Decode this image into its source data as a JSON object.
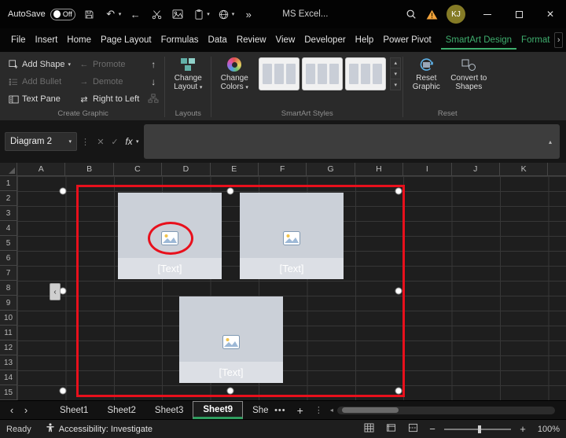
{
  "titlebar": {
    "autosave_label": "AutoSave",
    "autosave_state": "Off",
    "app_title": "MS Excel...",
    "avatar_initials": "KJ"
  },
  "menubar": {
    "items": [
      "File",
      "Insert",
      "Home",
      "Page Layout",
      "Formulas",
      "Data",
      "Review",
      "View",
      "Developer",
      "Help",
      "Power Pivot",
      "SmartArt Design",
      "Format"
    ],
    "active_item": "SmartArt Design"
  },
  "ribbon": {
    "create_graphic": {
      "label": "Create Graphic",
      "add_shape": "Add Shape",
      "add_bullet": "Add Bullet",
      "text_pane": "Text Pane",
      "promote": "Promote",
      "demote": "Demote",
      "right_to_left": "Right to Left"
    },
    "layouts": {
      "label": "Layouts",
      "change_layout": "Change Layout"
    },
    "smartart_styles": {
      "label": "SmartArt Styles",
      "change_colors": "Change Colors"
    },
    "reset": {
      "label": "Reset",
      "reset_graphic": "Reset Graphic",
      "convert_to_shapes": "Convert to Shapes"
    }
  },
  "formula_bar": {
    "name_box_value": "Diagram 2",
    "fx_label": "fx",
    "formula_value": ""
  },
  "grid": {
    "column_headers": [
      "A",
      "B",
      "C",
      "D",
      "E",
      "F",
      "G",
      "H",
      "I",
      "J",
      "K"
    ],
    "row_headers": [
      "1",
      "2",
      "3",
      "4",
      "5",
      "6",
      "7",
      "8",
      "9",
      "10",
      "11",
      "12",
      "13",
      "14",
      "15"
    ]
  },
  "smartart": {
    "shapes": [
      {
        "label": "[Text]"
      },
      {
        "label": "[Text]"
      },
      {
        "label": "[Text]"
      }
    ]
  },
  "sheet_tabs": {
    "tabs": [
      "Sheet1",
      "Sheet2",
      "Sheet3",
      "Sheet9",
      "She"
    ],
    "active_tab": "Sheet9"
  },
  "status_bar": {
    "mode": "Ready",
    "accessibility": "Accessibility: Investigate",
    "zoom_level": "100%"
  },
  "colors": {
    "accent_green": "#3fae6e",
    "annotation_red": "#e8101c",
    "smartart_fill": "#cbd0d8",
    "warning_orange": "#f2a33c"
  }
}
